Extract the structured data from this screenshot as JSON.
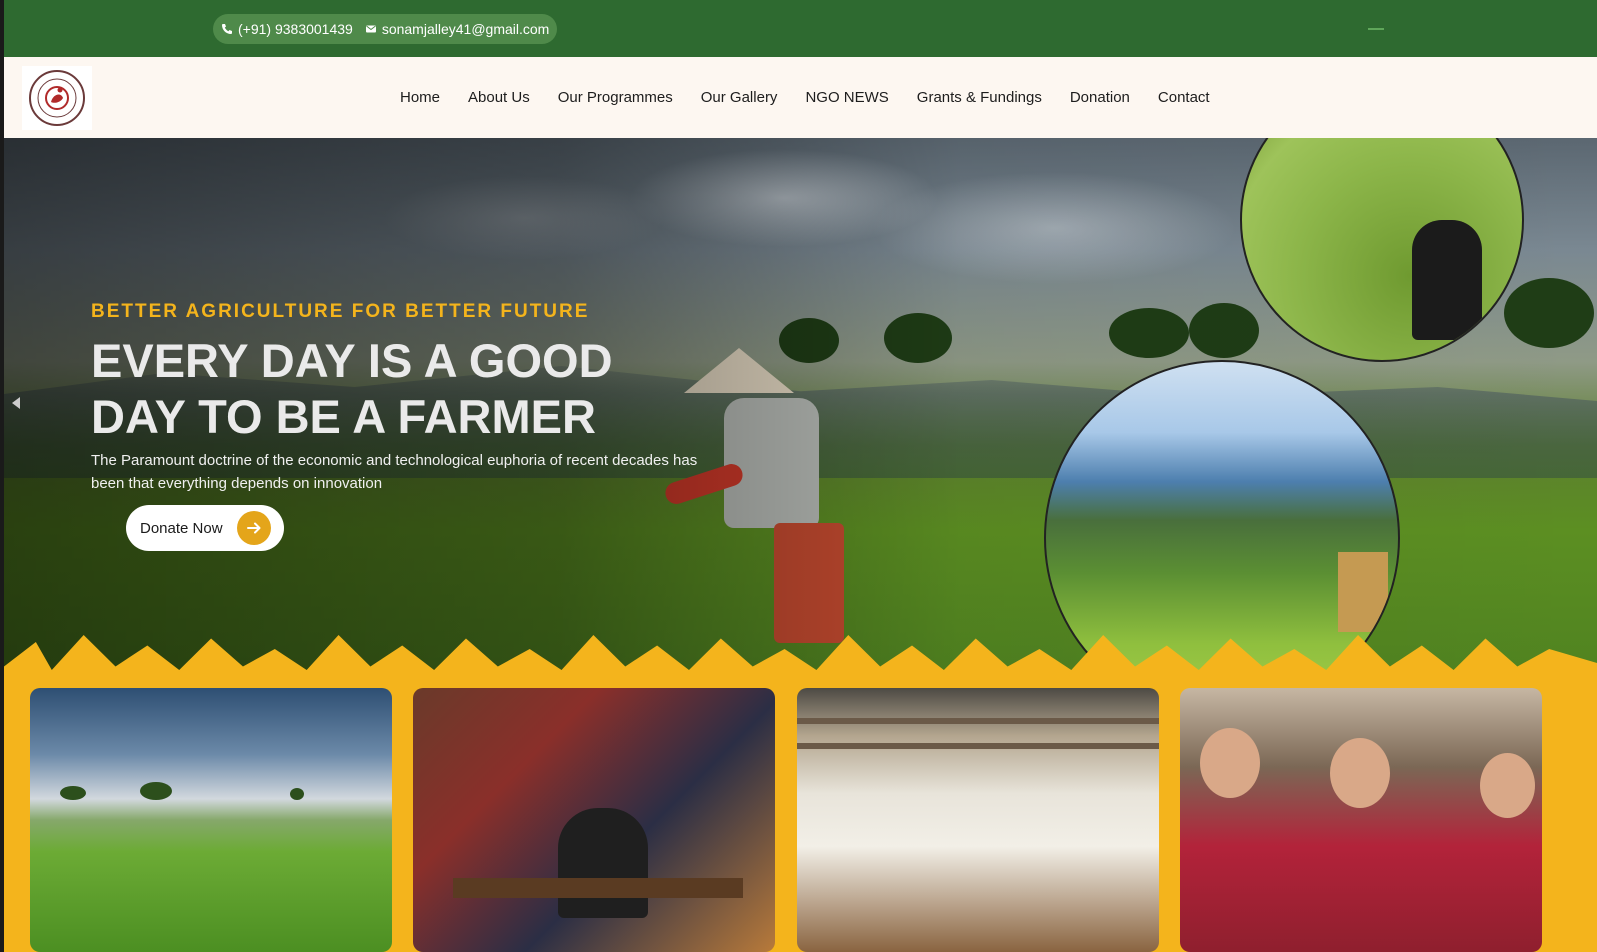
{
  "topbar": {
    "phone": "(+91) 9383001439",
    "email": "sonamjalley41@gmail.com",
    "phone_icon": "phone-icon",
    "email_icon": "mail-icon"
  },
  "nav": {
    "logo_icon": "ngo-logo",
    "items": [
      {
        "label": "Home"
      },
      {
        "label": "About Us"
      },
      {
        "label": "Our Programmes"
      },
      {
        "label": "Our Gallery"
      },
      {
        "label": "NGO NEWS"
      },
      {
        "label": "Grants & Fundings"
      },
      {
        "label": "Donation"
      },
      {
        "label": "Contact"
      }
    ]
  },
  "hero": {
    "kicker": "BETTER AGRICULTURE FOR BETTER FUTURE",
    "headline": "EVERY DAY IS A GOOD DAY TO BE A FARMER",
    "subtext": "The Paramount doctrine of the economic and technological euphoria of recent decades has been that everything depends on innovation",
    "donate_label": "Donate Now",
    "arrow_icon": "arrow-right-icon"
  },
  "colors": {
    "topbar": "#2e6a30",
    "accent_yellow": "#f4b41c",
    "nav_bg": "#fdf7f1"
  }
}
